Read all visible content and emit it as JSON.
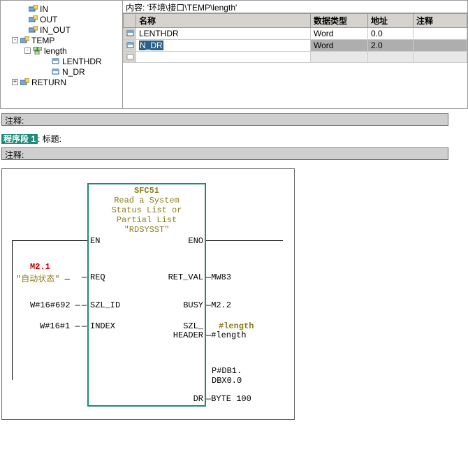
{
  "pathbar": "内容: '环境\\接口\\TEMP\\length'",
  "tree": {
    "in": "IN",
    "out": "OUT",
    "in_out": "IN_OUT",
    "temp": "TEMP",
    "length": "length",
    "lenthdr": "LENTHDR",
    "ndr": "N_DR",
    "return": "RETURN"
  },
  "table": {
    "headers": {
      "name": "名称",
      "type": "数据类型",
      "addr": "地址",
      "note": "注释"
    },
    "rows": [
      {
        "name": "LENTHDR",
        "type": "Word",
        "addr": "0.0",
        "note": ""
      },
      {
        "name": "N_DR",
        "type": "Word",
        "addr": "2.0",
        "note": ""
      }
    ]
  },
  "labels": {
    "comment": "注释:",
    "segment": "程序段 1",
    "title_suffix": ": 标题:"
  },
  "fbd": {
    "block_name": "SFC51",
    "block_desc1": "Read a System",
    "block_desc2": "Status List or",
    "block_desc3": "Partial List",
    "block_sym": "\"RDSYSST\"",
    "pins": {
      "en": "EN",
      "eno": "ENO",
      "req": "REQ",
      "ret_val": "RET_VAL",
      "szl_id": "SZL_ID",
      "busy": "BUSY",
      "index": "INDEX",
      "szl": "SZL_",
      "header": "HEADER",
      "dr": "DR"
    },
    "wires": {
      "req_top": "M2.1",
      "req_lbl": "\"自动状态\"",
      "szl_id": "W#16#692",
      "index": "W#16#1",
      "ret_val": "MW83",
      "busy": "M2.2",
      "header_top": "#length",
      "header": "#length",
      "dr1": "P#DB1.",
      "dr2": "DBX0.0",
      "dr3": "BYTE 100"
    }
  }
}
